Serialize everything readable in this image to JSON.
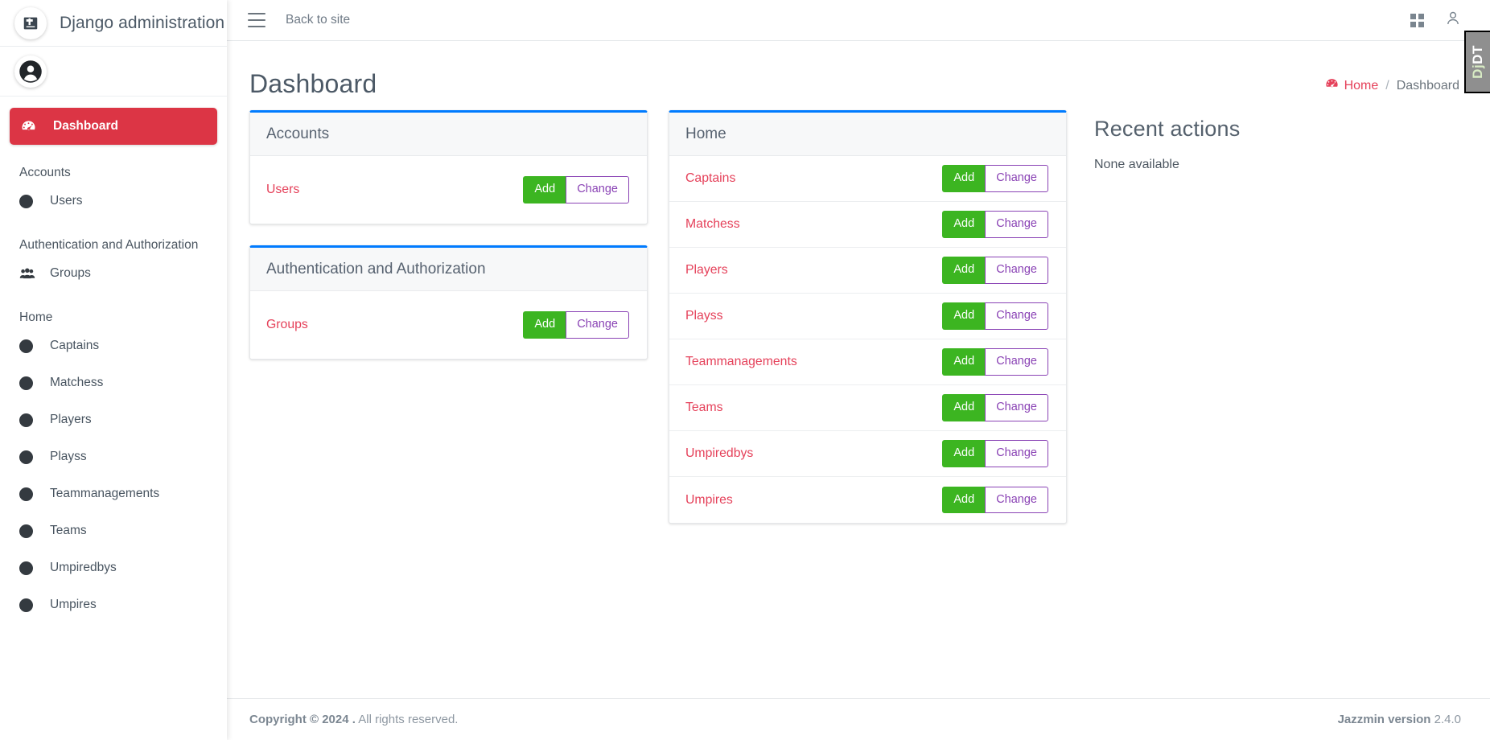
{
  "brand": {
    "title": "Django administration",
    "logo_icon": "django-logo-icon",
    "avatar_icon": "user-circle-icon"
  },
  "topnav": {
    "menu_icon": "hamburger-menu-icon",
    "back_to_site": "Back to site",
    "apps_icon": "grid-apps-icon",
    "account_icon": "user-account-icon"
  },
  "sidebar": {
    "active": {
      "label": "Dashboard",
      "icon": "tachometer-dashboard-icon"
    },
    "sections": [
      {
        "header": "Accounts",
        "items": [
          {
            "label": "Users",
            "icon": "circle-dot-icon"
          }
        ]
      },
      {
        "header": "Authentication and Authorization",
        "items": [
          {
            "label": "Groups",
            "icon": "users-group-icon"
          }
        ]
      },
      {
        "header": "Home",
        "items": [
          {
            "label": "Captains",
            "icon": "circle-dot-icon"
          },
          {
            "label": "Matchess",
            "icon": "circle-dot-icon"
          },
          {
            "label": "Players",
            "icon": "circle-dot-icon"
          },
          {
            "label": "Playss",
            "icon": "circle-dot-icon"
          },
          {
            "label": "Teammanagements",
            "icon": "circle-dot-icon"
          },
          {
            "label": "Teams",
            "icon": "circle-dot-icon"
          },
          {
            "label": "Umpiredbys",
            "icon": "circle-dot-icon"
          },
          {
            "label": "Umpires",
            "icon": "circle-dot-icon"
          }
        ]
      }
    ]
  },
  "page": {
    "title": "Dashboard",
    "breadcrumb": {
      "home_label": "Home",
      "home_icon": "tachometer-dashboard-icon",
      "separator": "/",
      "current": "Dashboard"
    }
  },
  "buttons": {
    "add_label": "Add",
    "change_label": "Change"
  },
  "cards": [
    {
      "title": "Accounts",
      "accent_color": "#007bff",
      "rows": [
        {
          "name": "Users"
        }
      ]
    },
    {
      "title": "Authentication and Authorization",
      "accent_color": "#007bff",
      "rows": [
        {
          "name": "Groups"
        }
      ]
    },
    {
      "title": "Home",
      "accent_color": "#007bff",
      "rows": [
        {
          "name": "Captains"
        },
        {
          "name": "Matchess"
        },
        {
          "name": "Players"
        },
        {
          "name": "Playss"
        },
        {
          "name": "Teammanagements"
        },
        {
          "name": "Teams"
        },
        {
          "name": "Umpiredbys"
        },
        {
          "name": "Umpires"
        }
      ]
    }
  ],
  "recent_actions": {
    "title": "Recent actions",
    "empty_text": "None available"
  },
  "footer": {
    "copyright_strong": "Copyright © 2024 .",
    "copyright_rest": " All rights reserved.",
    "version_strong": "Jazzmin version",
    "version_number": " 2.4.0"
  },
  "debug_toolbar": {
    "tab_prefix": "Dj",
    "tab_suffix": "DT"
  },
  "colors": {
    "accent_red": "#dc3545",
    "link_red": "#e5415a",
    "add_green": "#3cb521",
    "change_purple": "#8a43b5",
    "card_accent_blue": "#007bff"
  }
}
